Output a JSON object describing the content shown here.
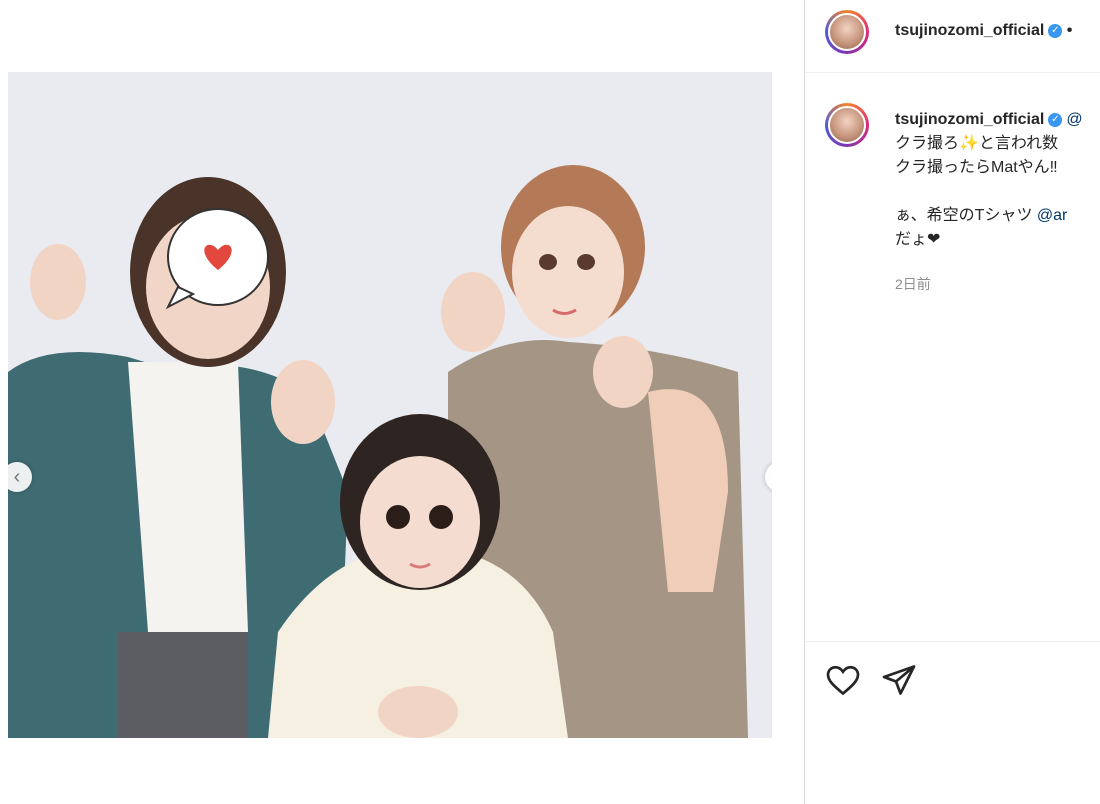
{
  "post": {
    "username": "tsujinozomi_official",
    "verified": true,
    "header_more": "•",
    "caption_lines": [
      "クラ撮ろ✨と言われ数",
      "クラ撮ったらMatやん‼︎"
    ],
    "caption_line2": "ぁ、希空のTシャツ ",
    "caption_mention": "@ar",
    "caption_line3": "だょ❤",
    "mention_tail": "@",
    "timestamp": "2日前"
  },
  "carousel": {
    "prev": "‹",
    "next": "›"
  },
  "icons": {
    "like": "heart-icon",
    "share": "paper-plane-icon",
    "verified": "verified-badge-icon"
  },
  "colors": {
    "accent": "#3897f0",
    "link": "#00376b",
    "muted": "#8e8e8e"
  }
}
